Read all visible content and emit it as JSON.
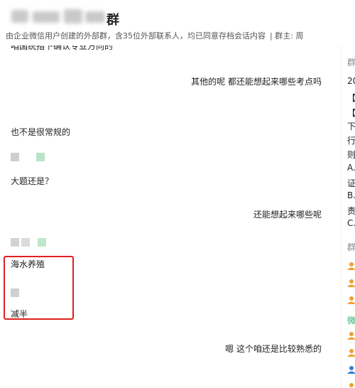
{
  "header": {
    "title_tail": "群",
    "subtitle": "由企业微信用户创建的外部群，含35位外部联系人，均已同意存档会话内容",
    "subtitle_group_owner": "| 群主: 周"
  },
  "chat": {
    "cutoff_line": "咱国统指下确认专业方向的",
    "messages": [
      {
        "side": "right",
        "text": "其他的呢  都还能想起来哪些考点吗"
      },
      {
        "side": "left",
        "text": "也不是很常规的"
      },
      {
        "side": "left",
        "text": "大题还是？"
      },
      {
        "side": "right",
        "text": "还能想起来哪些呢"
      },
      {
        "side": "left",
        "text": "海水养殖"
      },
      {
        "side": "left",
        "text": "减半"
      },
      {
        "side": "right",
        "text": "嗯 这个咱还是比较熟悉的"
      }
    ]
  },
  "sidebar": {
    "lines": [
      "群",
      "20",
      "【",
      "【",
      "下",
      "行",
      "则",
      "A.",
      "证",
      "B.",
      "责",
      "C."
    ],
    "label_members": "群",
    "label_wechat": "微",
    "colors": {
      "orange": "#f0a030",
      "blue": "#3a7bd5",
      "green": "#2aae67"
    }
  }
}
